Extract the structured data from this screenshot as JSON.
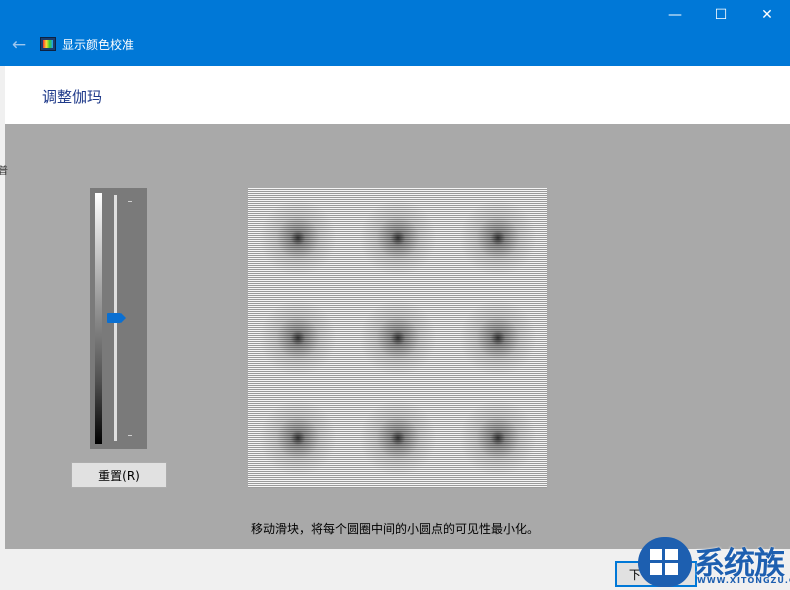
{
  "window": {
    "title": "显示颜色校准",
    "back_icon": "arrow-left-icon",
    "minimize_glyph": "—",
    "maximize_glyph": "☐",
    "close_glyph": "✕",
    "accent_color": "#0078d7"
  },
  "header": {
    "heading": "调整伽玛"
  },
  "slider": {
    "position": 0.5,
    "thumb_color": "#0a6fd1"
  },
  "reset_button": {
    "label": "重置(R)"
  },
  "instruction": "移动滑块，将每个圆圈中间的小圆点的可见性最小化。",
  "footer": {
    "next_label": "下一步(N)"
  },
  "watermark": {
    "text": "系统族",
    "url": "WWW.XITONGZU.COM"
  },
  "left_edge_glyph": "普"
}
